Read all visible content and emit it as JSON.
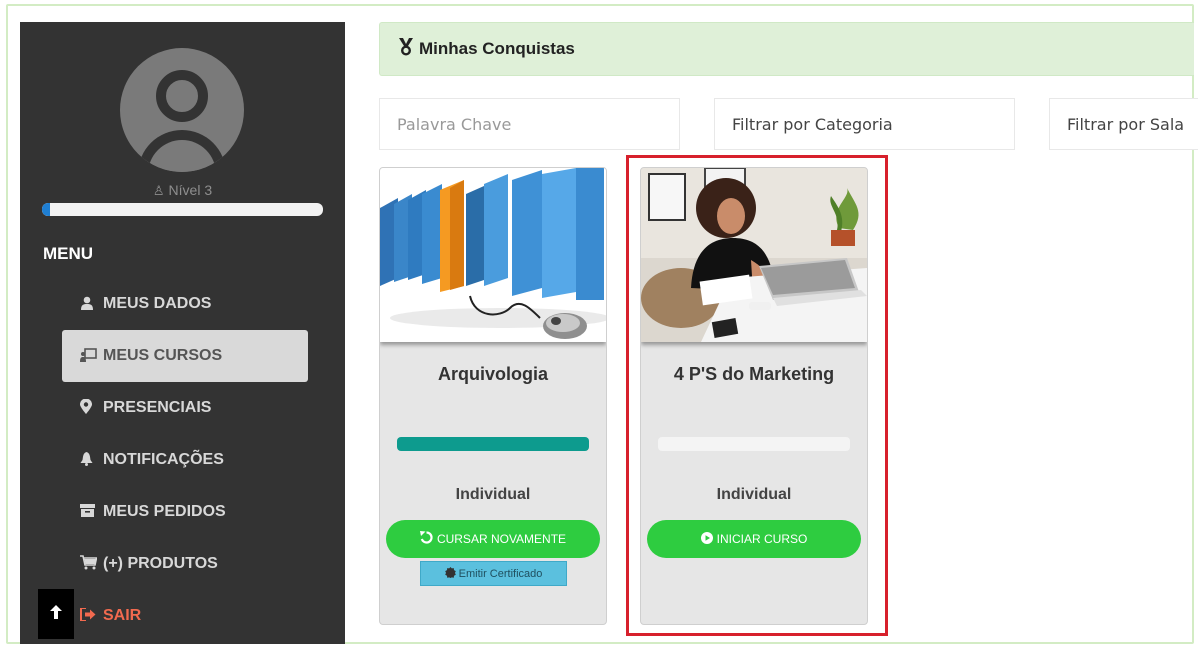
{
  "sidebar": {
    "level_label": "Nível 3",
    "level_progress": 0.03,
    "menu_title": "MENU",
    "items": [
      {
        "label": "MEUS DADOS",
        "icon": "user-icon",
        "glyph": "👤"
      },
      {
        "label": "MEUS CURSOS",
        "icon": "chalkboard-teacher-icon",
        "glyph": "🖵"
      },
      {
        "label": "PRESENCIAIS",
        "icon": "map-marker-icon",
        "glyph": "⚲"
      },
      {
        "label": "NOTIFICAÇÕES",
        "icon": "bell-icon",
        "glyph": "🔔"
      },
      {
        "label": "MEUS PEDIDOS",
        "icon": "archive-icon",
        "glyph": "▤"
      },
      {
        "label": "(+) PRODUTOS",
        "icon": "shopping-cart-icon",
        "glyph": "🛒"
      },
      {
        "label": "SAIR",
        "icon": "sign-out-icon",
        "glyph": "⇨"
      }
    ],
    "active_item": "MEUS CURSOS"
  },
  "header": {
    "title": "Minhas Conquistas",
    "icon": "medal-icon"
  },
  "filters": {
    "keyword_placeholder": "Palavra Chave",
    "category_label": "Filtrar por Categoria",
    "room_label": "Filtrar por Sala"
  },
  "courses": [
    {
      "title": "Arquivologia",
      "progress": 1.0,
      "type": "Individual",
      "action_label": "CURSAR NOVAMENTE",
      "action_icon": "undo-icon",
      "certificate_label": "Emitir Certificado",
      "certificate_icon": "certificate-icon",
      "image": "folders-with-mouse"
    },
    {
      "title": "4 P'S do Marketing",
      "progress": 0.0,
      "type": "Individual",
      "action_label": "INICIAR CURSO",
      "action_icon": "play-circle-icon",
      "image": "woman-at-laptop"
    }
  ],
  "colors": {
    "sidebar_bg": "#333333",
    "header_bg": "#dff0d8",
    "action_green": "#2ecc40",
    "progress_teal": "#0d9b8e",
    "certificate_blue": "#5bc0de",
    "logout_orange": "#f26a4f",
    "highlight_red": "#d7202c"
  }
}
